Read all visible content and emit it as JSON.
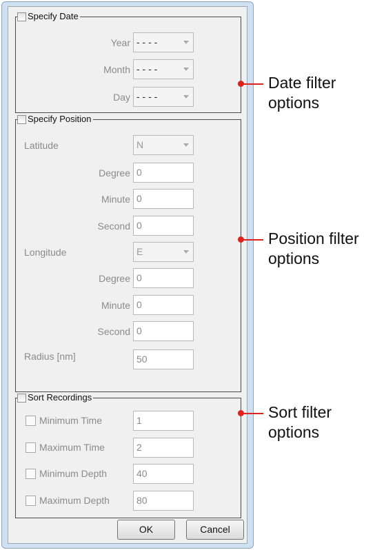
{
  "date_group": {
    "legend": "Specify Date",
    "year_label": "Year",
    "year_value": "- - - -",
    "month_label": "Month",
    "month_value": "- - - -",
    "day_label": "Day",
    "day_value": "- - - -"
  },
  "position_group": {
    "legend": "Specify Position",
    "latitude_label": "Latitude",
    "latitude_value": "N",
    "lat_degree_label": "Degree",
    "lat_degree_value": "0",
    "lat_minute_label": "Minute",
    "lat_minute_value": "0",
    "lat_second_label": "Second",
    "lat_second_value": "0",
    "longitude_label": "Longitude",
    "longitude_value": "E",
    "lon_degree_label": "Degree",
    "lon_degree_value": "0",
    "lon_minute_label": "Minute",
    "lon_minute_value": "0",
    "lon_second_label": "Second",
    "lon_second_value": "0",
    "radius_label": "Radius [nm]",
    "radius_value": "50"
  },
  "sort_group": {
    "legend": "Sort Recordings",
    "rows": [
      {
        "label": "Minimum Time",
        "value": "1"
      },
      {
        "label": "Maximum Time",
        "value": "2"
      },
      {
        "label": "Minimum Depth",
        "value": "40"
      },
      {
        "label": "Maximum Depth",
        "value": "80"
      }
    ]
  },
  "buttons": {
    "ok": "OK",
    "cancel": "Cancel"
  },
  "callouts": {
    "date": [
      "Date filter",
      "options"
    ],
    "position": [
      "Position filter",
      "options"
    ],
    "sort": [
      "Sort filter",
      "options"
    ]
  },
  "colors": {
    "callout": "#e0201a",
    "window_frame": "#cfe0f1",
    "dialog_bg": "#f0f0f0"
  }
}
